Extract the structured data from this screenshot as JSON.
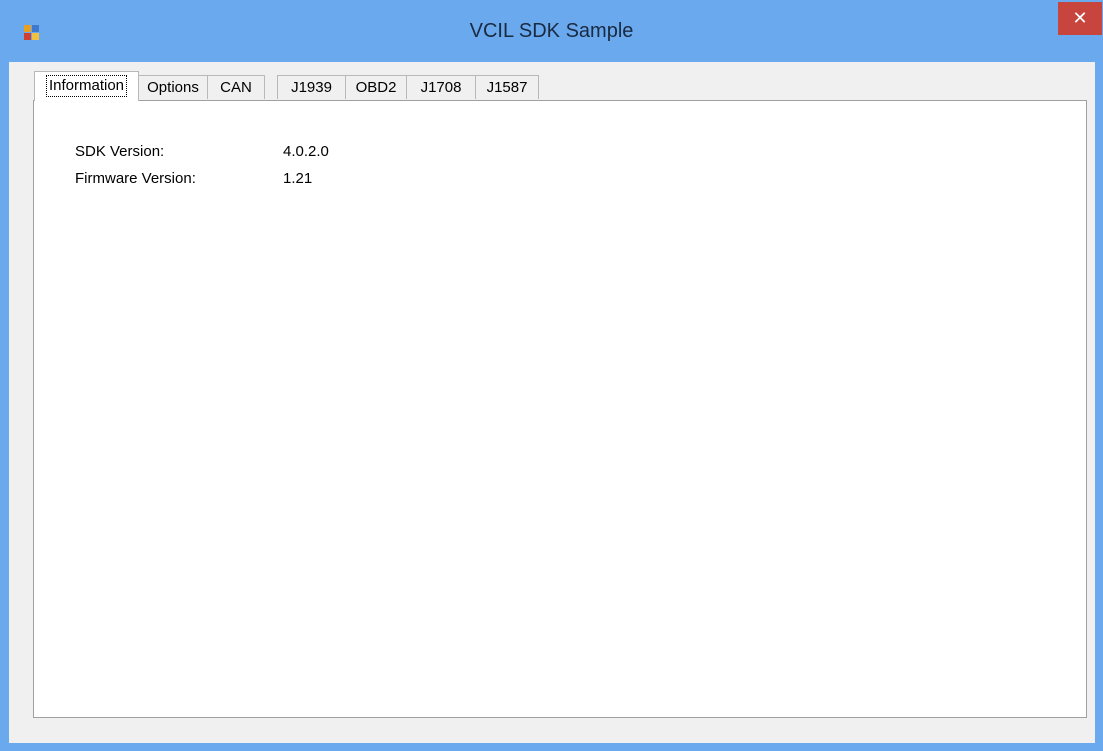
{
  "window": {
    "title": "VCIL SDK Sample",
    "close_glyph": "✕"
  },
  "colors": {
    "titlebar": "#6aa9ee",
    "close": "#c7453c"
  },
  "tabs": [
    {
      "label": "Information",
      "selected": true
    },
    {
      "label": "Options"
    },
    {
      "label": "CAN"
    },
    {
      "label": "J1939"
    },
    {
      "label": "OBD2"
    },
    {
      "label": "J1708"
    },
    {
      "label": "J1587"
    }
  ],
  "info": {
    "sdk_label": "SDK Version:",
    "sdk_value": "4.0.2.0",
    "firmware_label": "Firmware Version:",
    "firmware_value": "1.21"
  }
}
